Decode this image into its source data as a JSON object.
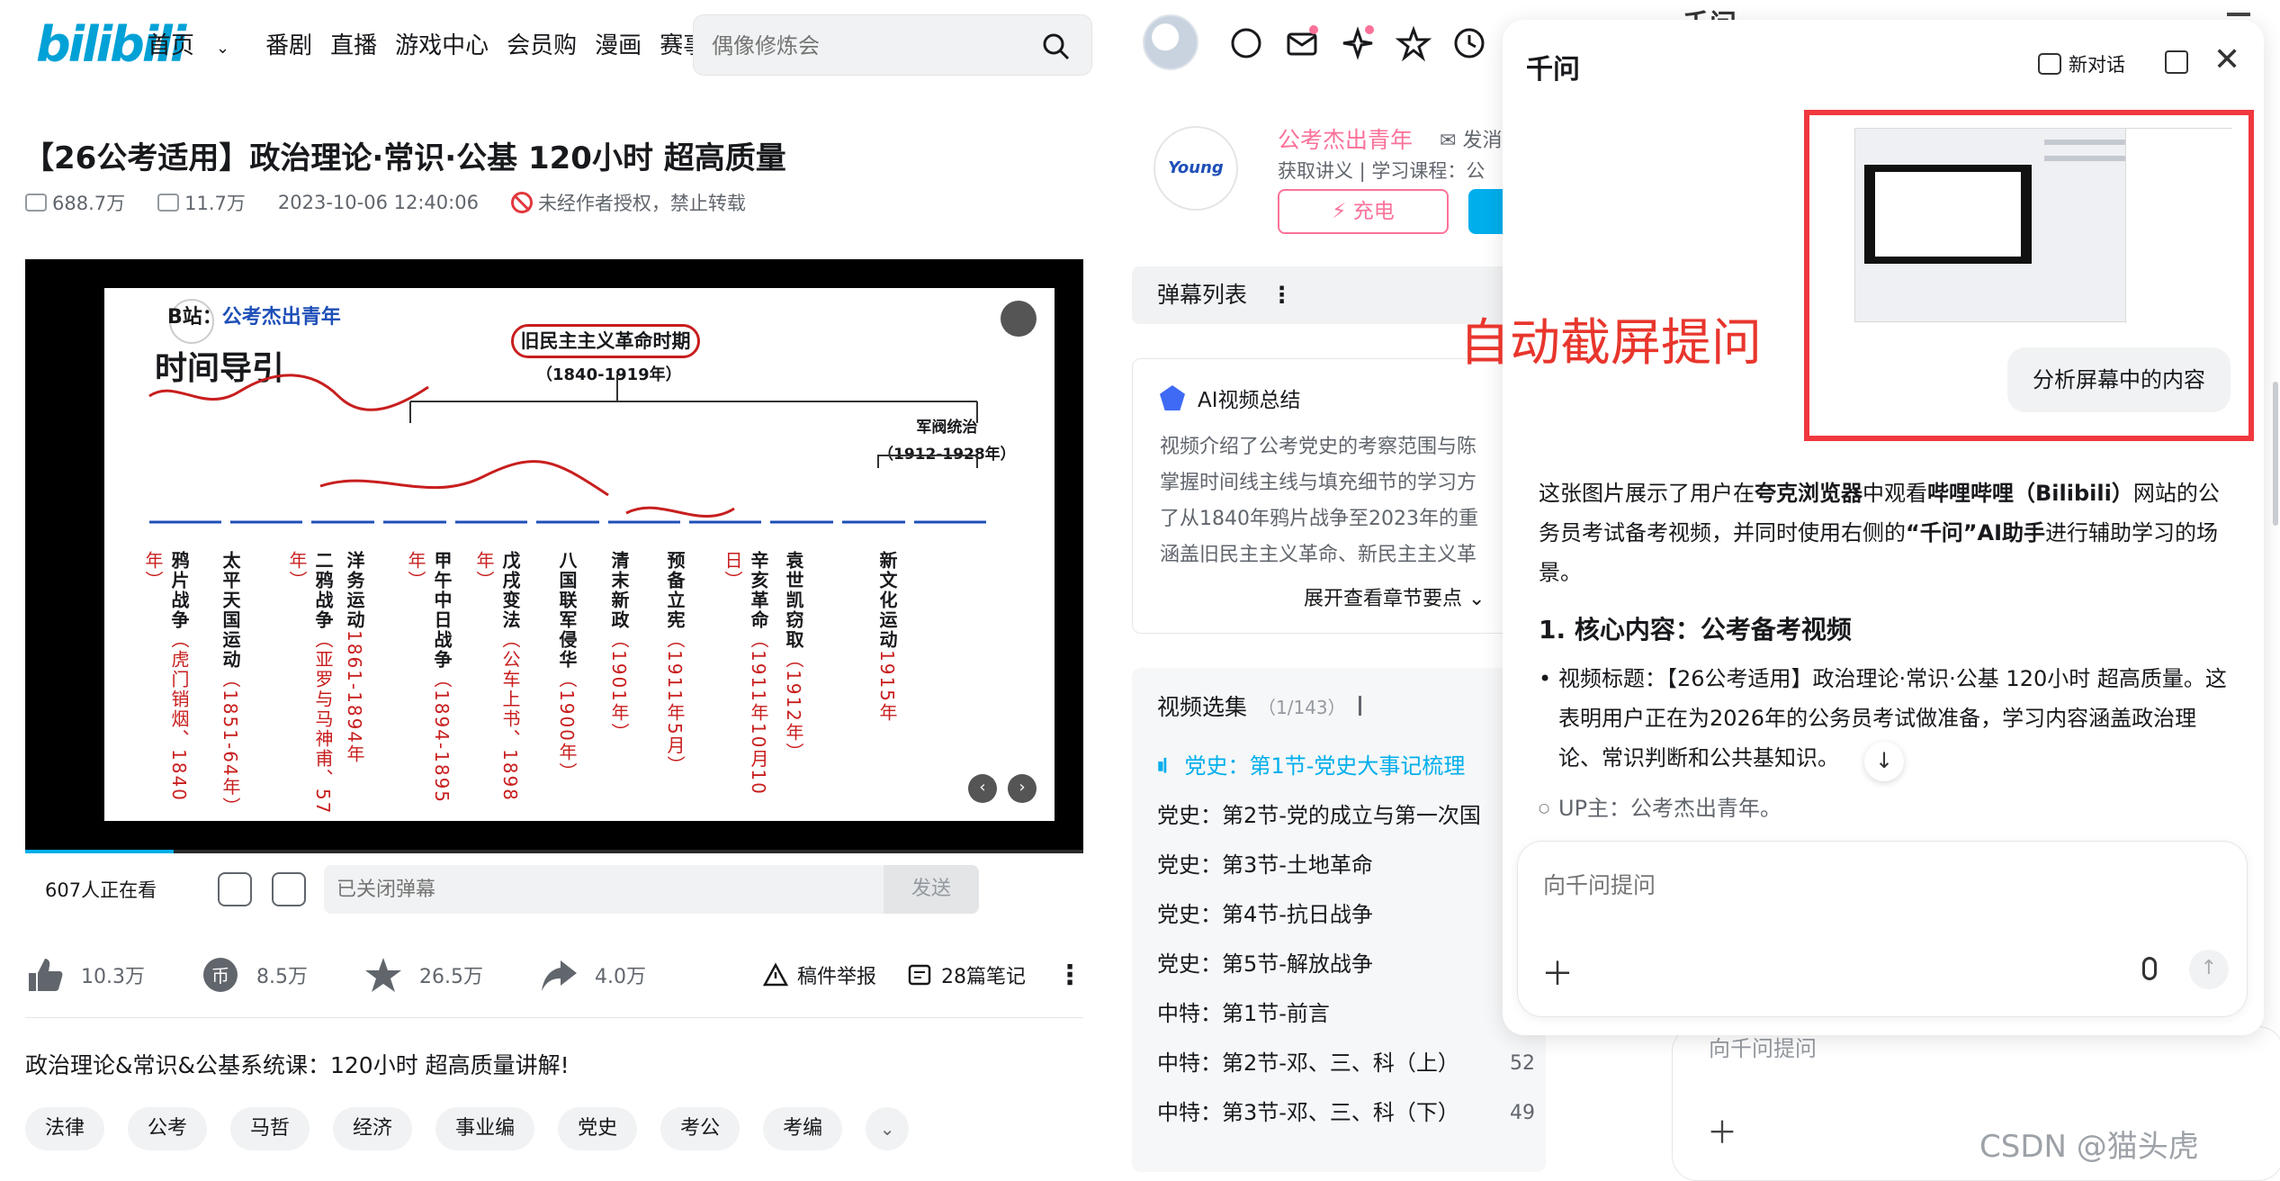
{
  "header": {
    "logo": "bilibili",
    "nav": [
      "首页",
      "番剧",
      "直播",
      "游戏中心",
      "会员购",
      "漫画",
      "赛事"
    ],
    "search_placeholder": "偶像修炼会"
  },
  "video": {
    "title": "【26公考适用】政治理论·常识·公基 120小时 超高质量",
    "views": "688.7万",
    "danmaku_count": "11.7万",
    "date": "2023-10-06 12:40:06",
    "copyright": "未经作者授权，禁止转载",
    "watching": "607人正在看",
    "danmaku_placeholder": "已关闭弹幕",
    "send_label": "发送",
    "likes": "10.3万",
    "coins": "8.5万",
    "favorites": "26.5万",
    "shares": "4.0万",
    "report_label": "稿件举报",
    "notes_label": "28篇笔记",
    "description": "政治理论&常识&公基系统课：120小时 超高质量讲解!",
    "tags": [
      "法律",
      "公考",
      "马哲",
      "经济",
      "事业编",
      "党史",
      "考公",
      "考编"
    ]
  },
  "slide": {
    "channel": "B站：",
    "channel_name": "公考杰出青年",
    "heading": "时间导引",
    "box_label": "旧民主主义革命时期",
    "period1": "（1840-1919年）",
    "period2_a": "军阀统治",
    "period2_b": "（1912-1928年）",
    "events": [
      {
        "name": "鸦片战争",
        "sub": "（虎门销烟、1840年）"
      },
      {
        "name": "太平天国运动",
        "sub": "（1851-64年）"
      },
      {
        "name": "二鸦战争",
        "sub": "（亚罗与马神甫、57年）"
      },
      {
        "name": "洋务运动",
        "sub": "1861-1894年"
      },
      {
        "name": "甲午中日战争",
        "sub": "（1894-1895年）"
      },
      {
        "name": "戊戌变法",
        "sub": "（公车上书、1898年）"
      },
      {
        "name": "八国联军侵华",
        "sub": "（1900年）"
      },
      {
        "name": "清末新政",
        "sub": "（1901年）"
      },
      {
        "name": "预备立宪",
        "sub": "（1911年5月）"
      },
      {
        "name": "辛亥革命",
        "sub": "（1911年10月10日）"
      },
      {
        "name": "袁世凯窃取",
        "sub": "（1912年）"
      },
      {
        "name": "新文化运动",
        "sub": "1915年"
      }
    ],
    "progress": 0.14
  },
  "uploader": {
    "avatar_text": "Young",
    "name": "公考杰出青年",
    "message": "发消",
    "desc": "获取讲义 | 学习课程：公",
    "charge": "充电"
  },
  "sidebar": {
    "danmaku_list": "弹幕列表",
    "ai_summary_title": "AI视频总结",
    "ai_summary": "视频介绍了公考党史的考察范围与陈\n掌握时间线主线与填充细节的学习方\n了从1840年鸦片战争至2023年的重\n涵盖旧民主主义革命、新民主主义革",
    "expand": "展开查看章节要点",
    "collection_title": "视频选集",
    "collection_count": "（1/143）",
    "episodes": [
      {
        "title": "党史：第1节-党史大事记梳理",
        "num": ""
      },
      {
        "title": "党史：第2节-党的成立与第一次国",
        "num": ""
      },
      {
        "title": "党史：第3节-土地革命",
        "num": ""
      },
      {
        "title": "党史：第4节-抗日战争",
        "num": ""
      },
      {
        "title": "党史：第5节-解放战争",
        "num": ""
      },
      {
        "title": "中特：第1节-前言",
        "num": ""
      },
      {
        "title": "中特：第2节-邓、三、科（上）",
        "num": "52"
      },
      {
        "title": "中特：第3节-邓、三、科（下）",
        "num": "49"
      }
    ]
  },
  "qianwen": {
    "title": "千问",
    "new_chat": "新对话",
    "analyze_btn": "分析屏幕中的内容",
    "annotation": "自动截屏提问",
    "intro_pre": "这张图片展示了用户在",
    "intro_b1": "夸克浏览器",
    "intro_mid": "中观看",
    "intro_b2": "哔哩哔哩（Bilibili）",
    "intro_mid2": "网站的公务员考试备考视频，并同时使用右侧的",
    "intro_b3": "“千问”AI助手",
    "intro_post": "进行辅助学习的场景。",
    "heading": "1. 核心内容：公考备考视频",
    "bullet1": "视频标题：【26公考适用】政治理论·常识·公基 120小时 超高质量。这表明用户正在为2026年的公务员考试做准备，学习内容涵盖政治理论、常识判断和公共基",
    "bullet1_tail": "知识。",
    "sub_bullet": "UP主：公考杰出青年。",
    "input_placeholder": "向千问提问",
    "behind_placeholder": "向千问提问",
    "behind_title": "千问"
  },
  "watermark": "CSDN @猫头虎",
  "colors": {
    "brand_blue": "#00a1d6",
    "pink": "#fb7299",
    "accent": "#00aeec",
    "annotation_red": "#e8362d"
  }
}
